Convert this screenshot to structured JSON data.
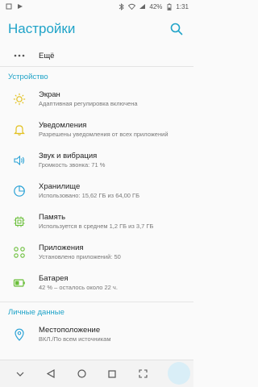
{
  "status_bar": {
    "battery": "42%",
    "time": "1:31"
  },
  "header": {
    "title": "Настройки"
  },
  "more_item": {
    "label": "Ещё"
  },
  "sections": {
    "device": "Устройство",
    "personal": "Личные данные"
  },
  "items": [
    {
      "title": "Экран",
      "subtitle": "Адаптивная регулировка включена",
      "icon": "brightness-icon"
    },
    {
      "title": "Уведомления",
      "subtitle": "Разрешены уведомления от всех приложений",
      "icon": "bell-icon"
    },
    {
      "title": "Звук и вибрация",
      "subtitle": "Громкость звонка: 71 %",
      "icon": "volume-icon"
    },
    {
      "title": "Хранилище",
      "subtitle": "Использовано: 15,62 ГБ из 64,00 ГБ",
      "icon": "storage-pie-icon"
    },
    {
      "title": "Память",
      "subtitle": "Используется в среднем 1,2 ГБ из 3,7 ГБ",
      "icon": "memory-chip-icon"
    },
    {
      "title": "Приложения",
      "subtitle": "Установлено приложений: 50",
      "icon": "apps-grid-icon"
    },
    {
      "title": "Батарея",
      "subtitle": "42 % – осталось около 22 ч.",
      "icon": "battery-icon"
    }
  ],
  "location_item": {
    "title": "Местоположение",
    "subtitle": "ВКЛ./По всем источникам",
    "icon": "location-pin-icon"
  },
  "colors": {
    "accent": "#1fa3c8",
    "icon_yellow": "#e2c01d",
    "icon_green": "#6bbf3a",
    "icon_blue": "#2aa2d6"
  }
}
